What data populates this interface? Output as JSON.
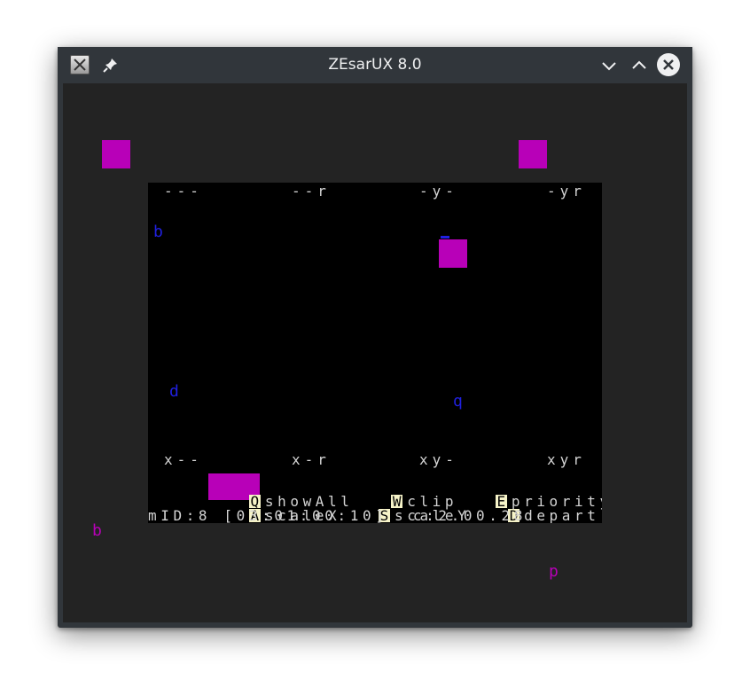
{
  "window": {
    "title": "ZEsarUX 8.0",
    "icons": {
      "app": "zesarux-app-icon",
      "pin": "pin-icon",
      "minimize": "chevron-down-icon",
      "maximize": "chevron-up-icon",
      "close": "close-icon"
    }
  },
  "screen": {
    "labels": {
      "top_left": "---",
      "top_mid1": "--r",
      "top_mid2": "-y-",
      "top_right": "-yr",
      "bot_left": "x--",
      "bot_mid1": "x-r",
      "bot_mid2": "xy-",
      "bot_right": "xyr"
    },
    "glyphs": {
      "b_top": "b",
      "d_mid": "d",
      "q_mid": "q",
      "b_outside": "b",
      "p_outside": "p"
    },
    "menu": {
      "row1": [
        {
          "key": "Q",
          "label": "showAll"
        },
        {
          "key": "W",
          "label": "clip"
        },
        {
          "key": "E",
          "label": "priority"
        }
      ],
      "row2": [
        {
          "key": "A",
          "label": "scaleX"
        },
        {
          "key": "S",
          "label": "scaleY"
        },
        {
          "key": "D",
          "label": "depart"
        }
      ],
      "status": "mID:8 [03:01:00:10]  c:2.00.28"
    }
  },
  "colors": {
    "sprite": "#b800b8",
    "glyph_blue": "#2020e0",
    "glyph_magenta": "#b800b8",
    "key_highlight": "#f6f3c8"
  }
}
